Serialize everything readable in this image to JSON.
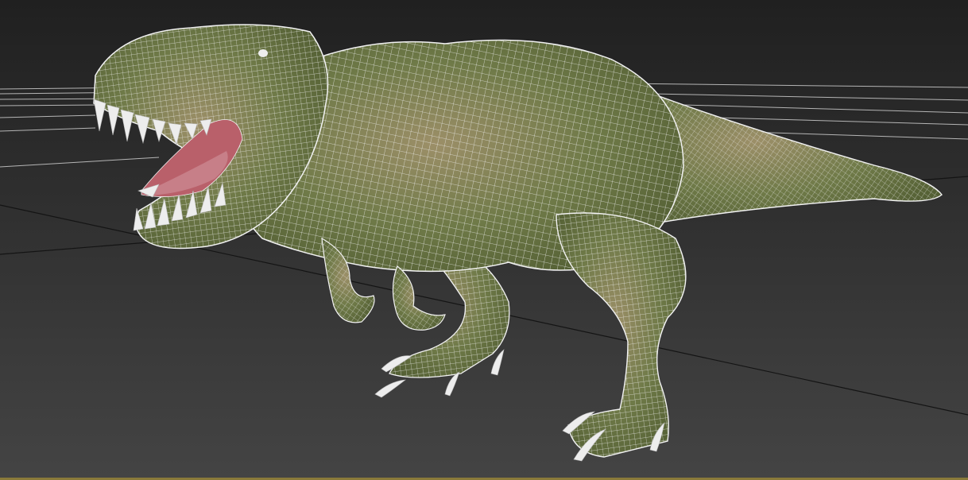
{
  "viewport": {
    "colors": {
      "background_top": "#202020",
      "background_bottom": "#444444",
      "grid_line": "#d8d8d8",
      "axis_line": "#141414",
      "wireframe": "#f2f2f2",
      "skin_dark": "#4e5a30",
      "skin_mid": "#6f7a48",
      "skin_light": "#9c8f68",
      "mouth": "#b9606a",
      "tongue": "#c9838c",
      "teeth": "#ededed",
      "active_border": "#8a7a3a"
    },
    "model": {
      "subject": "t-rex-model",
      "display_mode": "wireframe-over-shaded"
    }
  }
}
